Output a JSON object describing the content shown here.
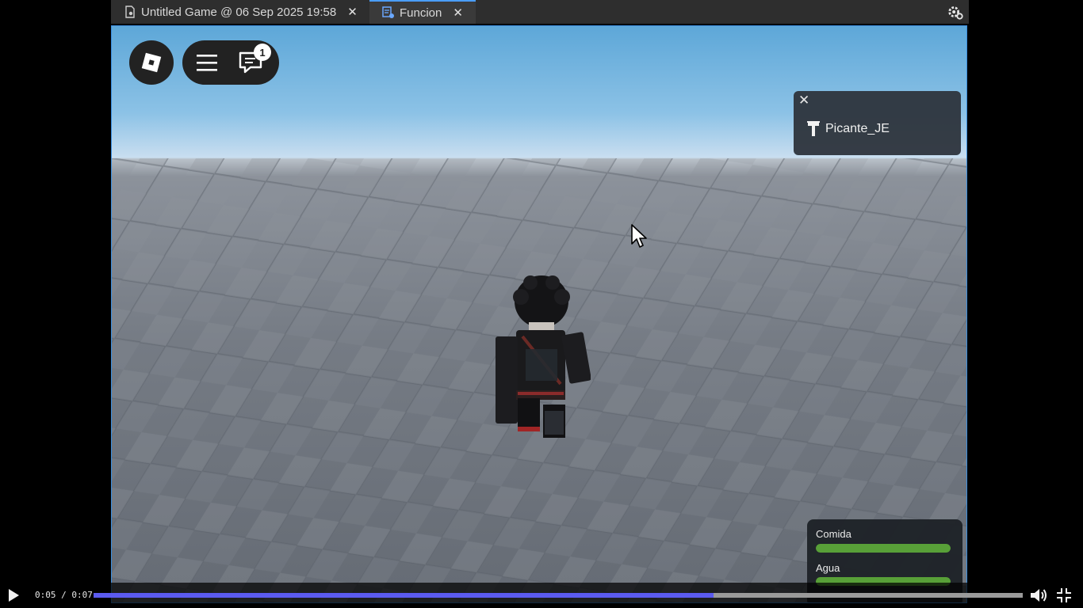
{
  "tabs": [
    {
      "label": "Untitled Game @ 06 Sep 2025 19:58",
      "icon": "game-file-icon",
      "close": "✕"
    },
    {
      "label": "Funcion",
      "icon": "script-icon",
      "close": "✕"
    }
  ],
  "settings_icon": "gear-icon",
  "roblox_ui": {
    "logo_icon": "roblox-logo-icon",
    "menu_icon": "hamburger-menu-icon",
    "chat_icon": "chat-icon",
    "chat_badge": "1"
  },
  "playerlist": {
    "close": "✕",
    "players": [
      {
        "name": "Picante_JE",
        "icon": "premium-player-icon"
      }
    ]
  },
  "stats": {
    "food": {
      "label": "Comida",
      "fill": 1.0
    },
    "water": {
      "label": "Agua",
      "fill": 1.0
    },
    "fill_color": "#58a038"
  },
  "video": {
    "time": "0:05 / 0:07",
    "progress": 0.667,
    "progress_color": "#5b5bf0"
  },
  "colors": {
    "accent": "#3b8fe0",
    "sky": "#5da7d8"
  }
}
